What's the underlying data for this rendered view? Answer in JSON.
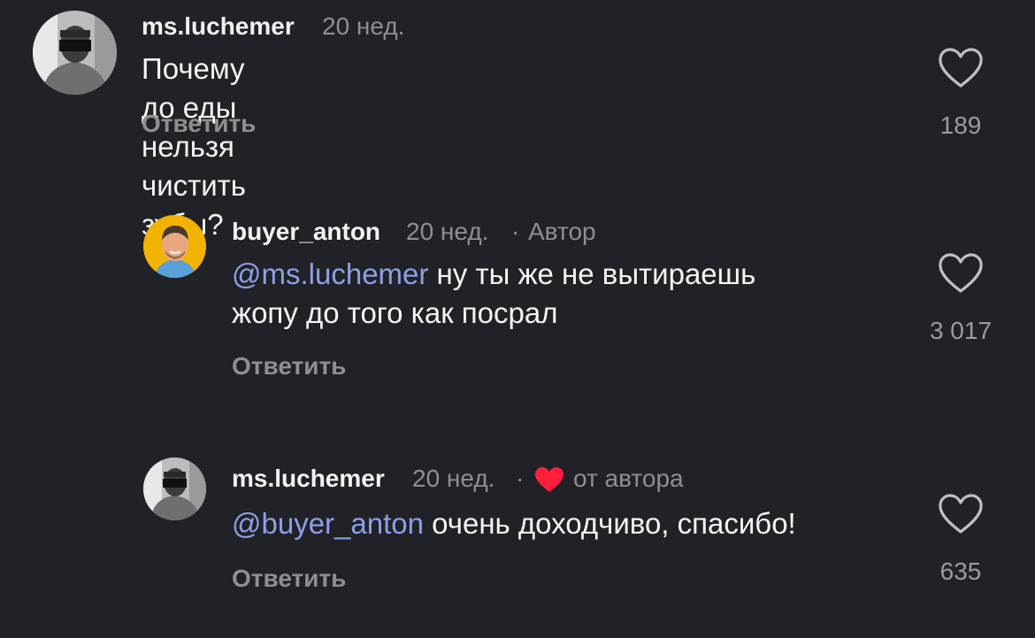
{
  "comments": [
    {
      "username": "ms.luchemer",
      "time": "20 нед.",
      "body": "Почему до еды нельзя чистить зубы?",
      "reply_label": "Ответить",
      "likes": "189"
    },
    {
      "username": "buyer_anton",
      "time": "20 нед.",
      "separator": "·",
      "author_badge": "Автор",
      "mention": "@ms.luchemer",
      "body_line1": " ну ты же не вытираешь",
      "body_line2": "жопу до того как посрал",
      "reply_label": "Ответить",
      "likes": "3 017"
    },
    {
      "username": "ms.luchemer",
      "time": "20 нед.",
      "separator": "·",
      "liked_by_author": "от автора",
      "mention": "@buyer_anton",
      "body": " очень доходчиво, спасибо!",
      "reply_label": "Ответить",
      "likes": "635"
    }
  ],
  "colors": {
    "background": "#202227",
    "mention": "#8f9fe6",
    "secondary_text": "#8e8e93",
    "heart_badge": "#ff1f3d"
  }
}
